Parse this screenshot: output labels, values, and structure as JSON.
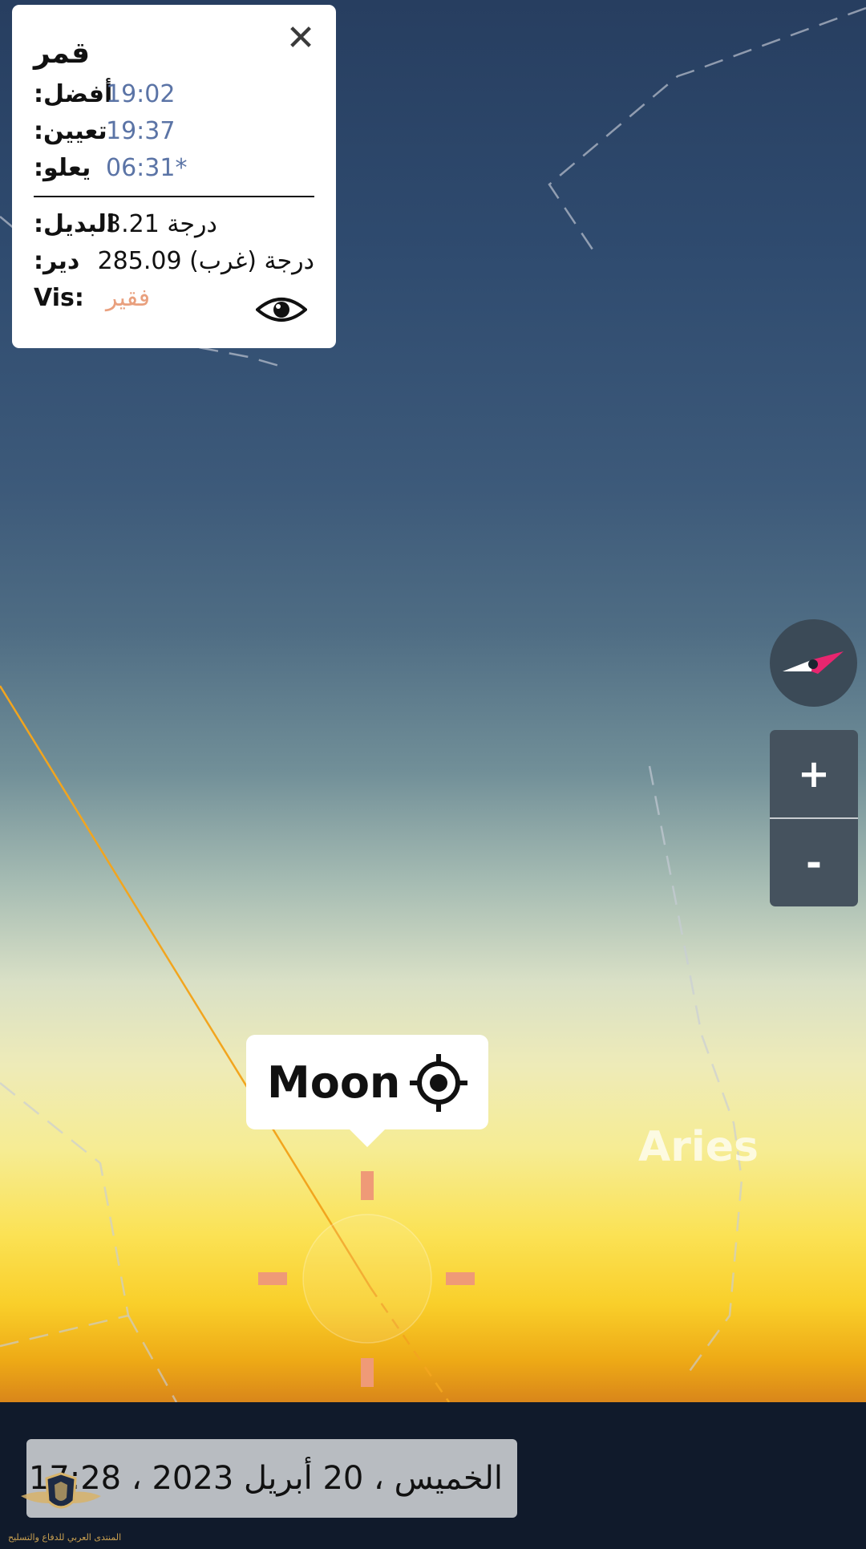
{
  "info_card": {
    "title": "قمر",
    "close_symbol": "✕",
    "best_label": ":أفضل",
    "best_time": "19:02",
    "set_label": ":تعيين",
    "set_time": "19:37",
    "rise_label": ":يعلو",
    "rise_time": "06:31*",
    "alt_label": ":البديل",
    "alt_value": "3.21 درجة",
    "az_label": ":دير",
    "az_value": "285.09 درجة (غرب)",
    "vis_label": "Vis:",
    "vis_value": "فقير",
    "vis_icon": "eye-icon"
  },
  "controls": {
    "compass_icon": "compass-icon",
    "zoom_in": "+",
    "zoom_out": "-"
  },
  "target": {
    "label": "Moon",
    "icon": "crosshair-icon"
  },
  "constellation": "Aries",
  "datetime": "الخميس ، 20 أبريل 2023 ، 17:28:",
  "watermark": "المنتدى العربي للدفاع والتسليح",
  "colors": {
    "time_blue": "#5b74a6",
    "visibility": "#e9a07e",
    "ecliptic": "#f2a51e",
    "reticle": "#ef9a77",
    "compass_needle": "#e8266f"
  }
}
